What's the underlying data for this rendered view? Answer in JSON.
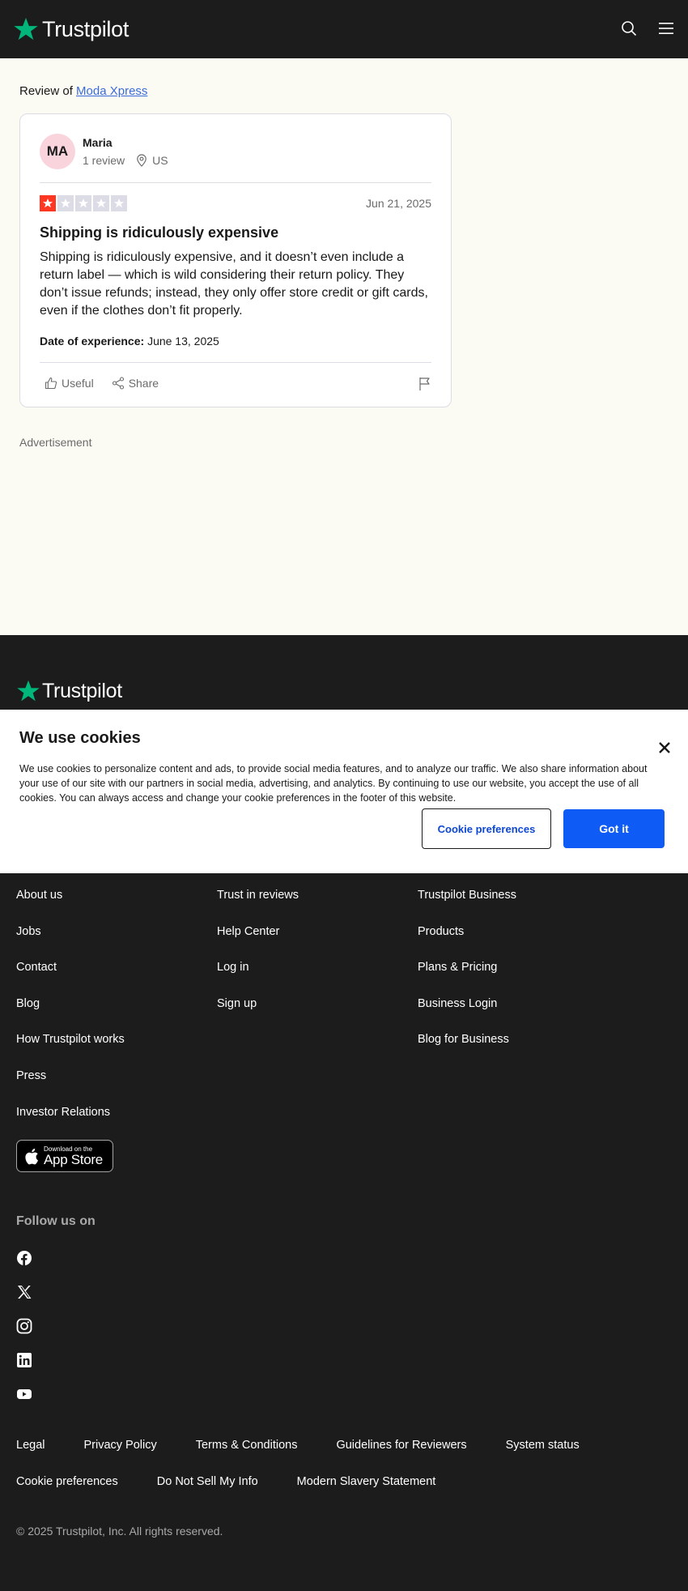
{
  "header": {
    "brand": "Trustpilot",
    "colors": {
      "brand_green": "#00b67a",
      "star_red": "#ff3722"
    }
  },
  "main": {
    "review_of_prefix": "Review of",
    "company": "Moda Xpress",
    "reviewer": {
      "initials": "MA",
      "name": "Maria",
      "reviews": "1 review",
      "country": "US"
    },
    "review": {
      "rating": 1,
      "rating_max": 5,
      "date": "Jun 21, 2025",
      "title": "Shipping is ridiculously expensive",
      "body": "Shipping is ridiculously expensive, and it doesn’t even include a return label — which is wild considering their return policy. They don’t issue refunds; instead, they only offer store credit or gift cards, even if the clothes don’t fit properly.",
      "experience_label": "Date of experience:",
      "experience_date": "June 13, 2025",
      "useful_label": "Useful",
      "share_label": "Share"
    },
    "ad_label": "Advertisement"
  },
  "cookie": {
    "title": "We use cookies",
    "text": "We use cookies to personalize content and ads, to provide social media features, and to analyze our traffic. We also share information about your use of our site with our partners in social media, advertising, and analytics. By continuing to use our website, you accept the use of all cookies. You can always access and change your cookie preferences in the footer of this website.",
    "preferences_button": "Cookie preferences",
    "accept_button": "Got it"
  },
  "footer": {
    "brand": "Trustpilot",
    "col1": [
      "About us",
      "Jobs",
      "Contact",
      "Blog",
      "How Trustpilot works",
      "Press",
      "Investor Relations"
    ],
    "col2": [
      "Trust in reviews",
      "Help Center",
      "Log in",
      "Sign up"
    ],
    "col3": [
      "Trustpilot Business",
      "Products",
      "Plans & Pricing",
      "Business Login",
      "Blog for Business"
    ],
    "appstore_small": "Download on the",
    "appstore_big": "App Store",
    "follow_label": "Follow us on",
    "social": [
      "facebook-icon",
      "x-icon",
      "instagram-icon",
      "linkedin-icon",
      "youtube-icon"
    ],
    "legal_row1": [
      "Legal",
      "Privacy Policy",
      "Terms & Conditions",
      "Guidelines for Reviewers",
      "System status"
    ],
    "legal_row2": [
      "Cookie preferences",
      "Do Not Sell My Info",
      "Modern Slavery Statement"
    ],
    "copyright": "© 2025 Trustpilot, Inc. All rights reserved."
  }
}
